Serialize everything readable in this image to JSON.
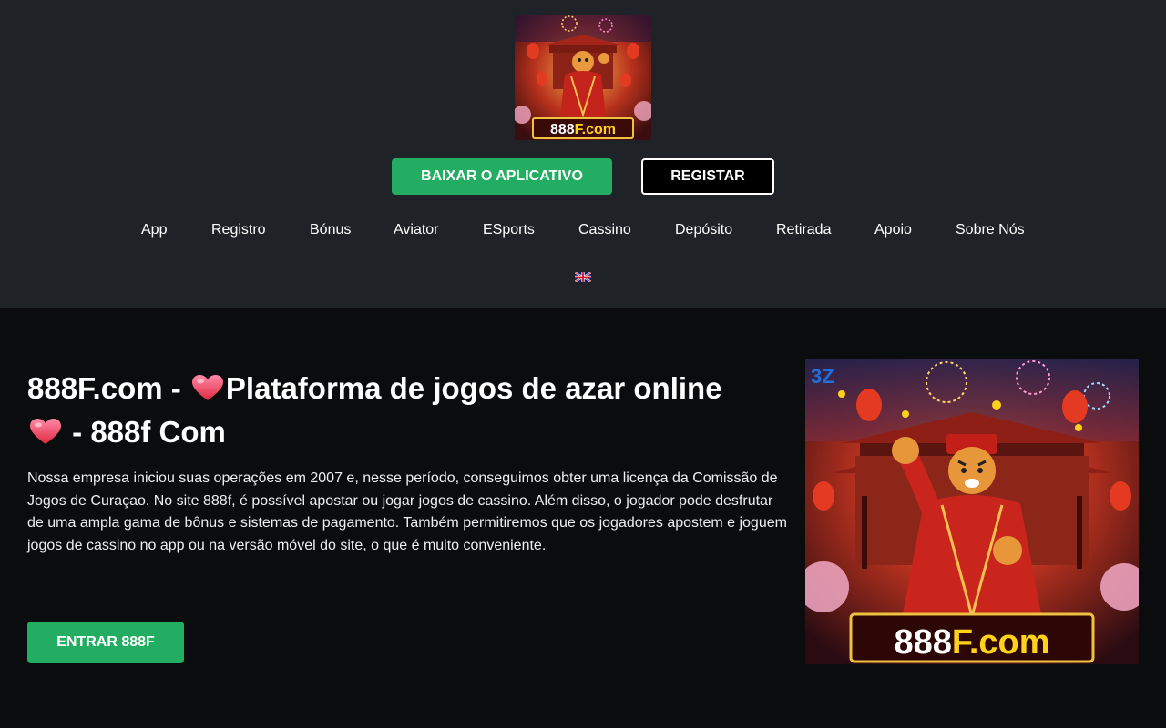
{
  "header": {
    "logo": {
      "icon": "tiger-logo-icon",
      "text_left": "888",
      "text_right": "F.com"
    },
    "download_button": "BAIXAR O APLICATIVO",
    "register_button": "REGISTAR",
    "nav": [
      "App",
      "Registro",
      "Bónus",
      "Aviator",
      "ESports",
      "Cassino",
      "Depósito",
      "Retirada",
      "Apoio",
      "Sobre Nós"
    ],
    "language_icon": "uk-flag-icon"
  },
  "main": {
    "title_part1": "888F.com -",
    "title_part2": "Plataforma de jogos de azar online",
    "title_part3": "- 888f Com",
    "heart_icon": "heart-icon",
    "description": "Nossa empresa iniciou suas operações em 2007 e, nesse período, conseguimos obter uma licença da Comissão de Jogos de Curaçao. No site 888f, é possível apostar ou jogar jogos de cassino. Além disso, o jogador pode desfrutar de uma ampla gama de bônus e sistemas de pagamento. Também permitiremos que os jogadores apostem e joguem jogos de cassino no app ou na versão móvel do site, o que é muito conveniente.",
    "enter_button": "ENTRAR 888F",
    "banner": {
      "icon": "tiger-banner-icon",
      "corner_logo": "3Z",
      "text_left": "888",
      "text_right": "F.com"
    }
  },
  "colors": {
    "header_bg": "#1f2227",
    "page_bg": "#0b0c0e",
    "accent_green": "#23ad62",
    "logo_yellow": "#ffd21a"
  }
}
